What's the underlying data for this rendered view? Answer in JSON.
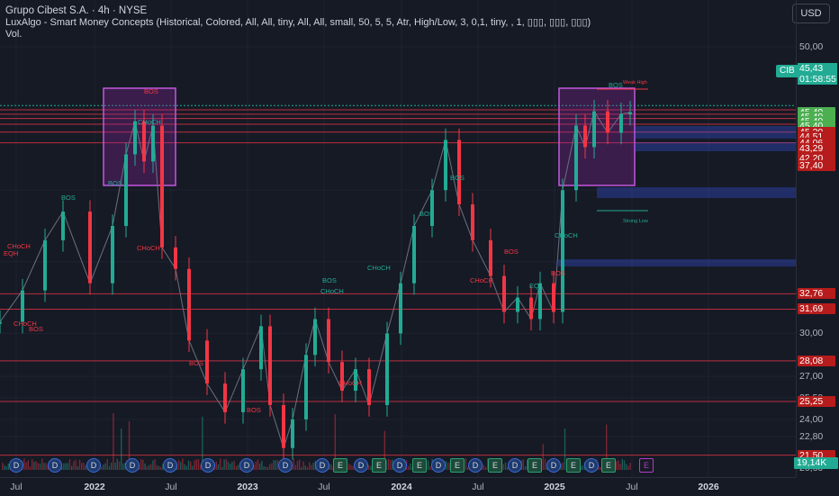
{
  "header": {
    "title": "Grupo Cibest S.A. · 4h · NYSE",
    "indicator": "LuxAlgo - Smart Money Concepts (Historical, Colored, All, All, tiny, All, All, small, 50, 5, 5, Atr, High/Low, 3, 0,1, tiny, , 1, ▯▯▯, ▯▯▯, ▯▯▯)",
    "volume_label": "Vol."
  },
  "currency_button": "USD",
  "symbol_badge": "CIB",
  "price_box": {
    "price": "45,43",
    "countdown": "01:58:55"
  },
  "volume_value": "19,14K",
  "price_axis": {
    "ticks": [
      {
        "label": "50,00",
        "value": 50.0
      },
      {
        "label": "30,00",
        "value": 30.0
      },
      {
        "label": "27,00",
        "value": 27.0
      },
      {
        "label": "25,50",
        "value": 25.5
      },
      {
        "label": "24,00",
        "value": 24.0
      },
      {
        "label": "22,80",
        "value": 22.8
      },
      {
        "label": "20,60",
        "value": 20.6
      }
    ],
    "tags": [
      {
        "label": "45,43",
        "value": 45.43,
        "color": "#22ab94"
      },
      {
        "label": "45,40",
        "value": 45.4,
        "color": "#4caf50"
      },
      {
        "label": "45,40",
        "value": 45.1,
        "color": "#4caf50"
      },
      {
        "label": "45,40",
        "value": 44.8,
        "color": "#4caf50"
      },
      {
        "label": "45,40",
        "value": 44.5,
        "color": "#4caf50"
      },
      {
        "label": "45,20",
        "value": 44.05,
        "color": "#b71c1c"
      },
      {
        "label": "44,51",
        "value": 43.7,
        "color": "#b71c1c"
      },
      {
        "label": "44,06",
        "value": 43.3,
        "color": "#b71c1c"
      },
      {
        "label": "43,29",
        "value": 42.9,
        "color": "#b71c1c"
      },
      {
        "label": "42,20",
        "value": 42.2,
        "color": "#b71c1c"
      },
      {
        "label": "37,40",
        "value": 41.7,
        "color": "#b71c1c"
      },
      {
        "label": "32,76",
        "value": 32.76,
        "color": "#b71c1c"
      },
      {
        "label": "31,69",
        "value": 31.69,
        "color": "#b71c1c"
      },
      {
        "label": "28,08",
        "value": 28.08,
        "color": "#b71c1c"
      },
      {
        "label": "25,25",
        "value": 25.25,
        "color": "#b71c1c"
      },
      {
        "label": "21,50",
        "value": 21.5,
        "color": "#b71c1c"
      }
    ]
  },
  "time_axis": [
    {
      "label": "Jul",
      "x": 18,
      "bold": false
    },
    {
      "label": "2022",
      "x": 105,
      "bold": true
    },
    {
      "label": "Jul",
      "x": 190,
      "bold": false
    },
    {
      "label": "2023",
      "x": 275,
      "bold": true
    },
    {
      "label": "Jul",
      "x": 360,
      "bold": false
    },
    {
      "label": "2024",
      "x": 446,
      "bold": true
    },
    {
      "label": "Jul",
      "x": 531,
      "bold": false
    },
    {
      "label": "2025",
      "x": 616,
      "bold": true
    },
    {
      "label": "Jul",
      "x": 702,
      "bold": false
    },
    {
      "label": "2026",
      "x": 787,
      "bold": true
    }
  ],
  "events": [
    {
      "type": "dividend",
      "label": "D",
      "x": 17
    },
    {
      "type": "dividend",
      "label": "D",
      "x": 60
    },
    {
      "type": "dividend",
      "label": "D",
      "x": 103
    },
    {
      "type": "dividend",
      "label": "D",
      "x": 146
    },
    {
      "type": "dividend",
      "label": "D",
      "x": 188
    },
    {
      "type": "dividend",
      "label": "D",
      "x": 230
    },
    {
      "type": "dividend",
      "label": "D",
      "x": 273
    },
    {
      "type": "dividend",
      "label": "D",
      "x": 316
    },
    {
      "type": "dividend",
      "label": "D",
      "x": 357
    },
    {
      "type": "earnings",
      "label": "E",
      "x": 377
    },
    {
      "type": "dividend",
      "label": "D",
      "x": 400
    },
    {
      "type": "earnings",
      "label": "E",
      "x": 420
    },
    {
      "type": "dividend",
      "label": "D",
      "x": 443
    },
    {
      "type": "earnings",
      "label": "E",
      "x": 465
    },
    {
      "type": "dividend",
      "label": "D",
      "x": 486
    },
    {
      "type": "earnings",
      "label": "E",
      "x": 507
    },
    {
      "type": "dividend",
      "label": "D",
      "x": 527
    },
    {
      "type": "earnings",
      "label": "E",
      "x": 549
    },
    {
      "type": "dividend",
      "label": "D",
      "x": 571
    },
    {
      "type": "earnings",
      "label": "E",
      "x": 593
    },
    {
      "type": "dividend",
      "label": "D",
      "x": 614
    },
    {
      "type": "earnings",
      "label": "E",
      "x": 636
    },
    {
      "type": "dividend",
      "label": "D",
      "x": 656
    },
    {
      "type": "earnings",
      "label": "E",
      "x": 675
    },
    {
      "type": "earnings_upcoming",
      "label": "E",
      "x": 717
    }
  ],
  "annotations": {
    "bos": "BOS",
    "choch": "CHoCH",
    "eqh": "EQH",
    "eql": "EQL",
    "weak_high": "Weak High",
    "strong_low": "Strong Low"
  },
  "colors": {
    "background": "#161a25",
    "bull": "#22ab94",
    "bear": "#f23645",
    "zone": "#9c27b0",
    "demand": "#3d5afe"
  },
  "chart_data": {
    "type": "line",
    "title": "",
    "xlabel": "",
    "ylabel": "",
    "ylim": [
      20.5,
      51
    ],
    "series": [
      {
        "name": "",
        "x": [
          0,
          25,
          50,
          70,
          100,
          125,
          140,
          150,
          160,
          170,
          180,
          195,
          210,
          230,
          250,
          270,
          290,
          300,
          315,
          325,
          340,
          350,
          365,
          380,
          395,
          410,
          430,
          445,
          460,
          480,
          495,
          510,
          525,
          545,
          560,
          575,
          590,
          600,
          615,
          625,
          640,
          650,
          660,
          675,
          690,
          700
        ],
        "values": [
          30.8,
          33.0,
          36.5,
          38.5,
          33.5,
          37.5,
          42.5,
          44.8,
          42.0,
          44.5,
          36.0,
          34.5,
          29.5,
          26.5,
          24.5,
          27.5,
          30.5,
          25.0,
          22.0,
          24.0,
          28.5,
          31.0,
          28.0,
          26.0,
          27.5,
          25.0,
          30.0,
          33.5,
          37.5,
          40.0,
          43.5,
          39.0,
          36.5,
          34.0,
          31.5,
          32.5,
          31.0,
          33.5,
          31.5,
          40.0,
          44.5,
          43.0,
          45.5,
          44.0,
          45.3,
          45.43
        ]
      }
    ]
  }
}
